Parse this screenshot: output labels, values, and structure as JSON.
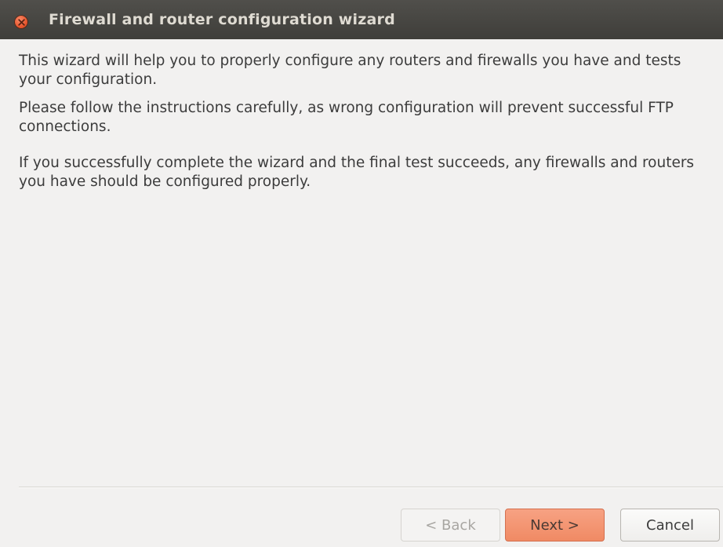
{
  "window": {
    "title": "Firewall and router configuration wizard",
    "close_icon": "close-icon"
  },
  "content": {
    "paragraph1": "This wizard will help you to properly configure any routers and firewalls you have and tests your configuration.",
    "paragraph2": "Please follow the instructions carefully, as wrong configuration will prevent successful FTP connections.",
    "paragraph3": "If you successfully complete the wizard and the final test succeeds, any firewalls and routers you have should be configured properly."
  },
  "buttons": {
    "back_label": "< Back",
    "next_label": "Next >",
    "cancel_label": "Cancel"
  },
  "colors": {
    "titlebar": "#3f3e3a",
    "close_button": "#e6532a",
    "next_button": "#f08a64",
    "background": "#f2f1f0"
  }
}
